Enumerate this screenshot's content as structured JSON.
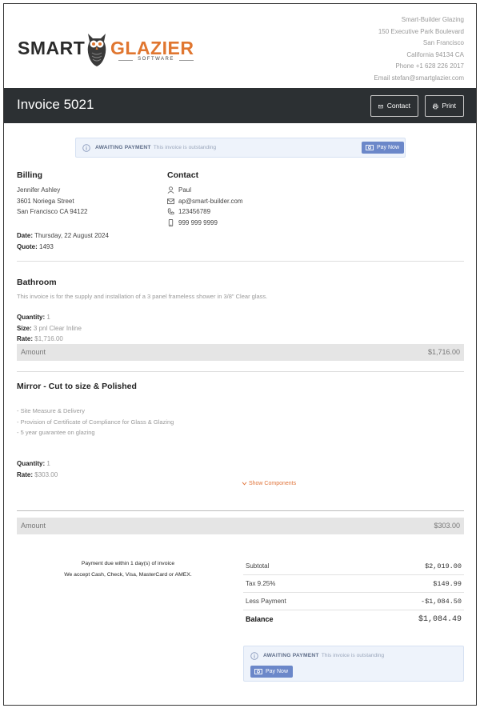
{
  "logo": {
    "smart": "SMART",
    "glazier": "GLAZIER",
    "software": "SOFTWARE"
  },
  "company": {
    "name": "Smart-Builder Glazing",
    "address1": "150 Executive Park Boulevard",
    "city": "San Francisco",
    "state_zip": "California 94134 CA",
    "phone": "Phone +1 628 226 2017",
    "email": "Email stefan@smartglazier.com"
  },
  "header": {
    "title": "Invoice 5021",
    "contact_label": "Contact",
    "print_label": "Print"
  },
  "banner": {
    "status": "AWAITING PAYMENT",
    "message": "This invoice is outstanding",
    "pay_label": "Pay Now"
  },
  "billing": {
    "heading": "Billing",
    "name": "Jennifer Ashley",
    "street": "3601 Noriega Street",
    "city": "San Francisco CA 94122",
    "date_label": "Date:",
    "date": "Thursday, 22 August 2024",
    "quote_label": "Quote:",
    "quote": "1493"
  },
  "contact": {
    "heading": "Contact",
    "person": "Paul",
    "email": "ap@smart-builder.com",
    "phone": "123456789",
    "mobile": "999 999 9999"
  },
  "items": [
    {
      "title": "Bathroom",
      "description": "This invoice is for the supply and installation of a 3 panel frameless shower in 3/8\" Clear glass.",
      "quantity_label": "Quantity:",
      "quantity": "1",
      "size_label": "Size:",
      "size": "3 pnl Clear Inline",
      "rate_label": "Rate:",
      "rate": "$1,716.00",
      "amount_label": "Amount",
      "amount": "$1,716.00"
    },
    {
      "title": "Mirror - Cut to size & Polished",
      "lines": [
        "- Site Measure & Delivery",
        "- Provision of Certificate of Compliance for Glass & Glazing",
        "- 5 year guarantee on glazing"
      ],
      "quantity_label": "Quantity:",
      "quantity": "1",
      "rate_label": "Rate:",
      "rate": "$303.00",
      "show_components": "Show Components",
      "amount_label": "Amount",
      "amount": "$303.00"
    }
  ],
  "terms": {
    "line1": "Payment due within 1 day(s) of invoice",
    "line2": "We accept Cash, Check, Visa, MasterCard or AMEX."
  },
  "totals": {
    "subtotal_label": "Subtotal",
    "subtotal": "$2,019.00",
    "tax_label": "Tax 9.25%",
    "tax": "$149.99",
    "payment_label": "Less Payment",
    "payment": "-$1,084.50",
    "balance_label": "Balance",
    "balance": "$1,084.49"
  },
  "colors": {
    "header_bg": "#2c3033",
    "accent_orange": "#e07630",
    "pay_button": "#6b87c9",
    "banner_bg": "#eef3fb"
  },
  "icons": [
    "owl-logo-icon",
    "envelope-icon",
    "printer-icon",
    "info-icon",
    "cash-icon",
    "user-icon",
    "phone-icon",
    "mobile-icon",
    "chevron-down-icon"
  ]
}
